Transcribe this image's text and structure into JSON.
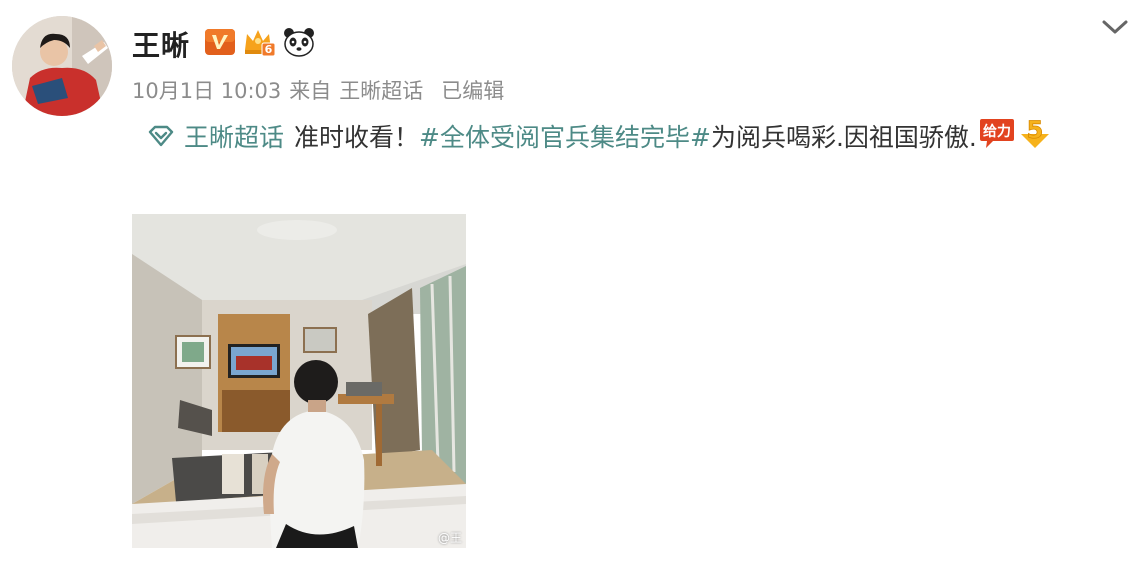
{
  "post": {
    "username": "王晰",
    "timestamp": "10月1日 10:03",
    "source_prefix": "来自",
    "source": "王晰超话",
    "edited": "已编辑",
    "supertopic": "王晰超话",
    "text_plain_1": "准时收看！",
    "hashtag": "#全体受阅官兵集结完毕#",
    "text_plain_2": "为阅兵喝彩.因祖国骄傲.",
    "badges": [
      "verified-v-icon",
      "crown-level-icon",
      "panda-icon"
    ],
    "crown_level": "6",
    "emoji_labels": [
      "给力"
    ],
    "emoji_badge_number": "5",
    "photo_watermark": "@王",
    "colors": {
      "link": "#4d8a86",
      "meta": "#8c8c8c",
      "vip_orange": "#f28a1d"
    }
  }
}
